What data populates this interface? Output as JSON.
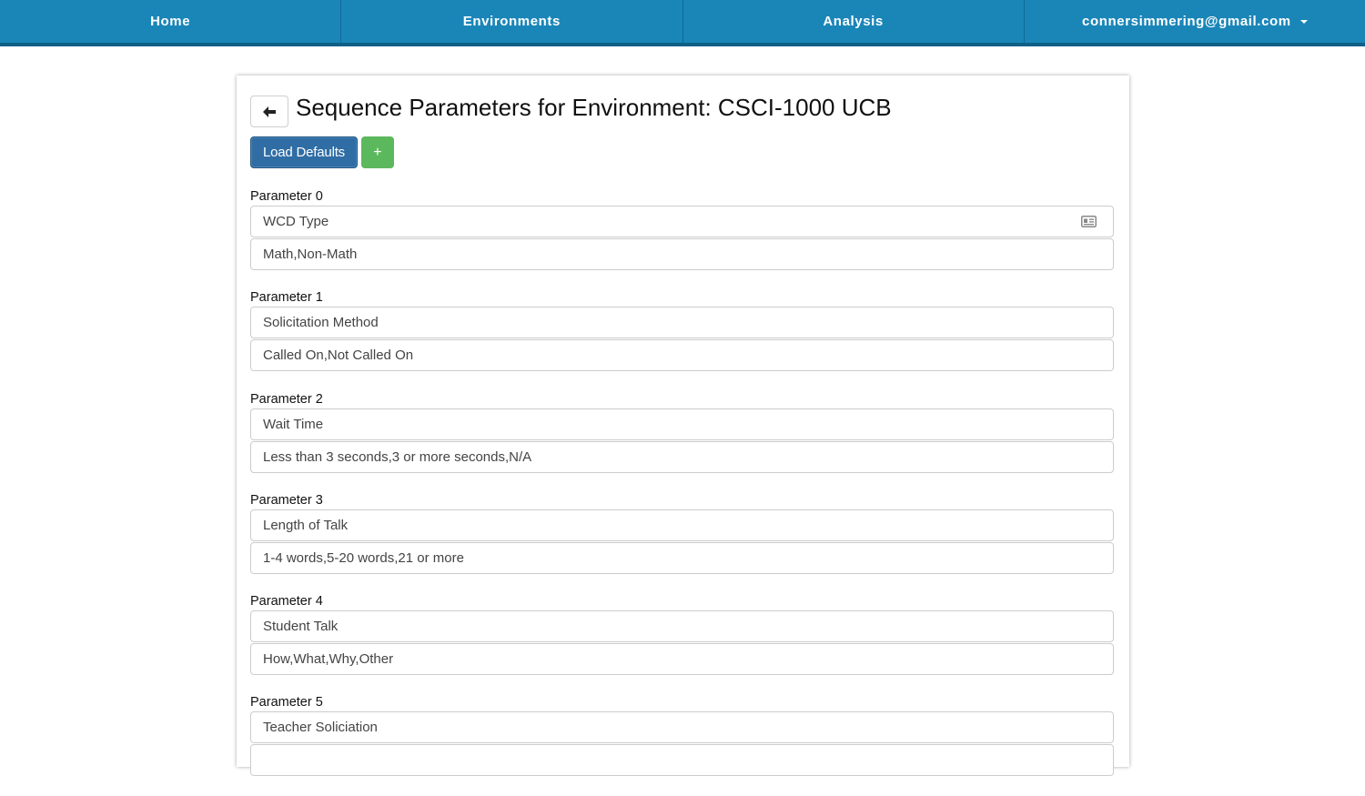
{
  "nav": {
    "items": [
      {
        "label": "Home"
      },
      {
        "label": "Environments"
      },
      {
        "label": "Analysis"
      },
      {
        "label": "connersimmering@gmail.com"
      }
    ]
  },
  "page": {
    "title": "Sequence Parameters for Environment: CSCI-1000 UCB",
    "load_defaults_label": "Load Defaults",
    "add_label": "+"
  },
  "parameters": [
    {
      "label": "Parameter 0",
      "name": "WCD Type",
      "values": "Math,Non-Math"
    },
    {
      "label": "Parameter 1",
      "name": "Solicitation Method",
      "values": "Called On,Not Called On"
    },
    {
      "label": "Parameter 2",
      "name": "Wait Time",
      "values": "Less than 3 seconds,3 or more seconds,N/A"
    },
    {
      "label": "Parameter 3",
      "name": "Length of Talk",
      "values": "1-4 words,5-20 words,21 or more"
    },
    {
      "label": "Parameter 4",
      "name": "Student Talk",
      "values": "How,What,Why,Other"
    },
    {
      "label": "Parameter 5",
      "name": "Teacher Soliciation",
      "values": ""
    }
  ],
  "icons": {
    "back": "arrow-left-icon",
    "contact_card": "contact-card-icon"
  },
  "colors": {
    "navbar": "#1a86b8",
    "primary_button": "#2f6da4",
    "success_button": "#5cb85c"
  }
}
